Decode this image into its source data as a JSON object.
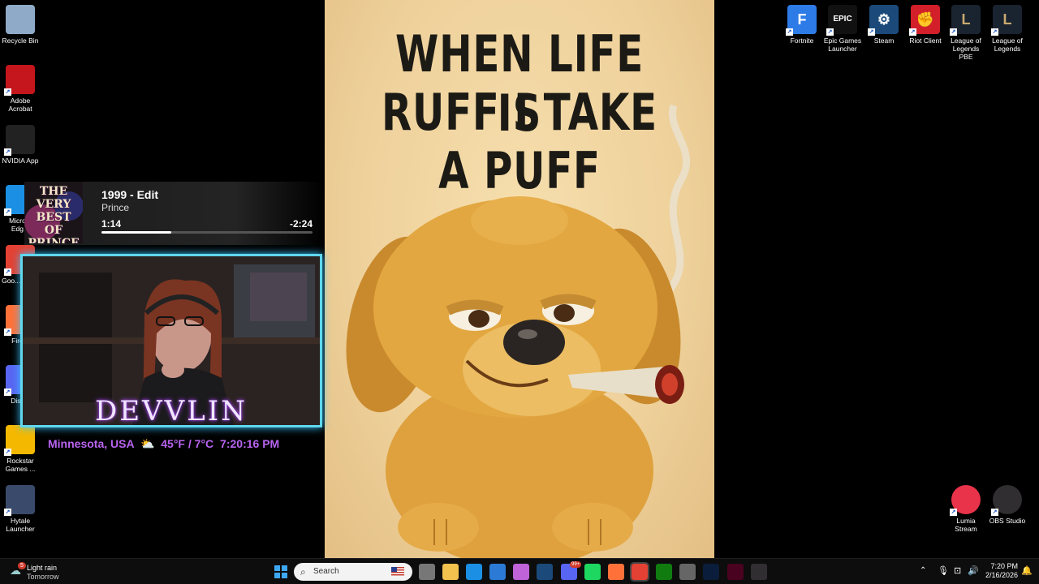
{
  "desktop_icons_left": [
    {
      "name": "recycle-bin",
      "label": "Recycle Bin",
      "icon": "recycle-bin-icon",
      "color": "#8fa9c8"
    },
    {
      "name": "adobe-acrobat",
      "label": "Adobe Acrobat",
      "icon": "acrobat-icon",
      "color": "#c4161c"
    },
    {
      "name": "nvidia-app",
      "label": "NVIDIA App",
      "icon": "nvidia-icon",
      "color": "#222222"
    },
    {
      "name": "microsoft-edge",
      "label": "Micro... Edg...",
      "icon": "edge-icon",
      "color": "#1a8fe3"
    },
    {
      "name": "google-chrome",
      "label": "Goo... Chr...",
      "icon": "chrome-icon",
      "color": "#e34133"
    },
    {
      "name": "firefox",
      "label": "Fire...",
      "icon": "firefox-icon",
      "color": "#ff7139"
    },
    {
      "name": "discord",
      "label": "Disc...",
      "icon": "discord-icon",
      "color": "#5865f2"
    },
    {
      "name": "rockstar-games",
      "label": "Rockstar Games ...",
      "icon": "rockstar-icon",
      "color": "#f5b800"
    },
    {
      "name": "hytale-launcher",
      "label": "Hytale Launcher",
      "icon": "hytale-icon",
      "color": "#3a4a6a"
    }
  ],
  "desktop_icons_right": [
    {
      "name": "fortnite",
      "label": "Fortnite",
      "icon": "fortnite-icon",
      "color": "#2d7be6",
      "glyph": "F"
    },
    {
      "name": "epic-games",
      "label": "Epic Games Launcher",
      "icon": "epic-games-icon",
      "color": "#111111",
      "glyph": "EPIC"
    },
    {
      "name": "steam",
      "label": "Steam",
      "icon": "steam-icon",
      "color": "#1b4a7a",
      "glyph": "⚙"
    },
    {
      "name": "riot-client",
      "label": "Riot Client",
      "icon": "riot-fist-icon",
      "color": "#d31f2a",
      "glyph": "✊"
    },
    {
      "name": "lol-pbe",
      "label": "League of Legends PBE",
      "icon": "league-icon",
      "color": "#1a2330",
      "glyph": "L"
    },
    {
      "name": "lol",
      "label": "League of Legends",
      "icon": "league-icon",
      "color": "#1a2330",
      "glyph": "L"
    }
  ],
  "desktop_icons_bottom_right": [
    {
      "name": "lumia-stream",
      "label": "Lumia Stream",
      "icon": "lumia-icon",
      "color": "#e8334a"
    },
    {
      "name": "obs-studio",
      "label": "OBS Studio",
      "icon": "obs-icon",
      "color": "#302e31"
    }
  ],
  "poster": {
    "lines": [
      "WHEN LIFE IS",
      "RUFF I TAKE",
      "A PUFF"
    ]
  },
  "now_playing": {
    "title": "1999 - Edit",
    "artist": "Prince",
    "elapsed": "1:14",
    "remaining": "-2:24",
    "progress": 0.33,
    "album_text": "THE VERY BEST OF PRINCE"
  },
  "overlay": {
    "streamer_name": "DEVVLIN",
    "location": "Minnesota, USA",
    "weather_icon": "partly-cloudy-icon",
    "temperature": "45°F / 7°C",
    "clock": "7:20:16 PM"
  },
  "taskbar": {
    "weather_temp_badge": "5",
    "weather_condition": "Light rain",
    "weather_when": "Tomorrow",
    "search_placeholder": "Search",
    "notification_badge": "99+",
    "time": "7:20 PM",
    "date": "2/16/2026"
  }
}
